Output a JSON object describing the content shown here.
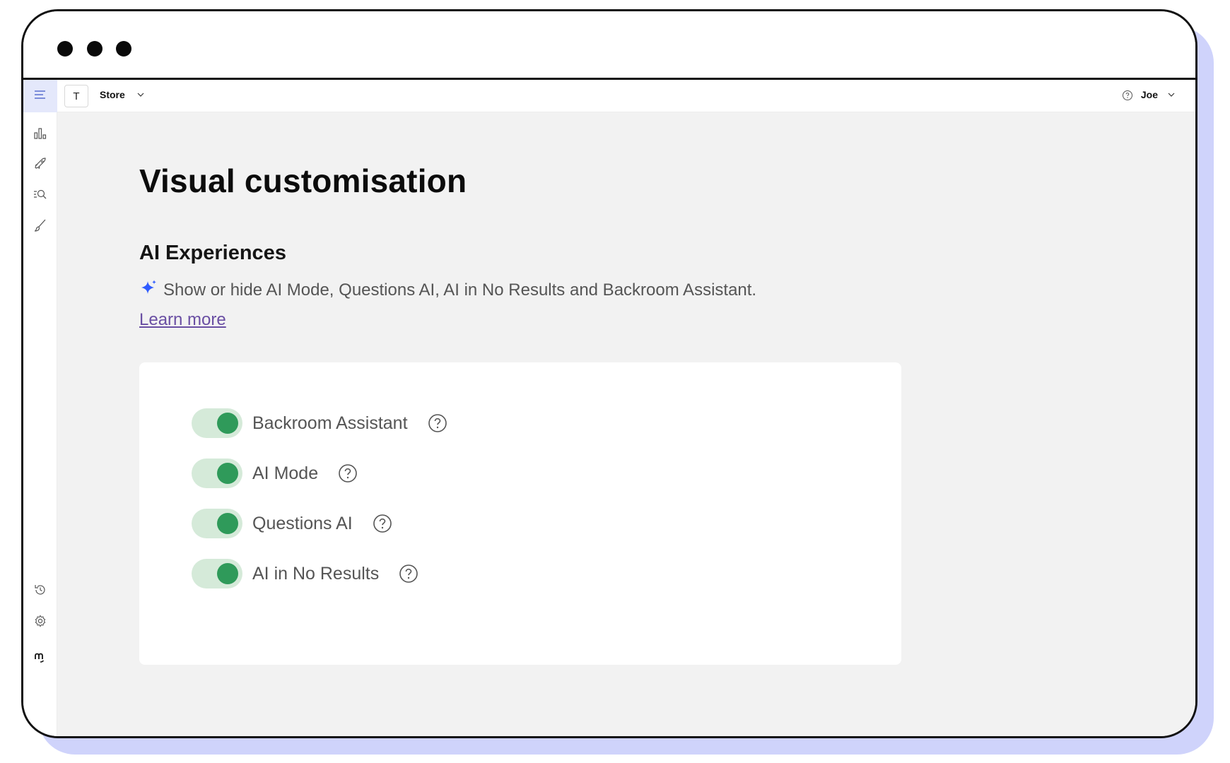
{
  "topbar": {
    "store_initial": "T",
    "store_label": "Store",
    "user_label": "Joe"
  },
  "sidebar": {
    "items": [
      {
        "icon": "chart-icon"
      },
      {
        "icon": "rocket-icon"
      },
      {
        "icon": "search-list-icon"
      },
      {
        "icon": "brush-icon"
      },
      {
        "icon": "history-icon"
      },
      {
        "icon": "gear-icon"
      },
      {
        "icon": "brand-logo-icon"
      }
    ]
  },
  "main": {
    "page_title": "Visual customisation",
    "section_title": "AI Experiences",
    "description": "Show or hide AI Mode, Questions AI, AI in No Results and Backroom Assistant.",
    "learn_more": "Learn more",
    "toggles": [
      {
        "label": "Backroom Assistant",
        "enabled": true
      },
      {
        "label": "AI Mode",
        "enabled": true
      },
      {
        "label": "Questions AI",
        "enabled": true
      },
      {
        "label": "AI in No Results",
        "enabled": true
      }
    ]
  },
  "colors": {
    "accent_sparkle": "#2f5bff",
    "toggle_on_track": "#d5ead9",
    "toggle_on_knob": "#2f9a5a",
    "link": "#6a4fa3",
    "frame_shadow": "#cfd3fb"
  }
}
